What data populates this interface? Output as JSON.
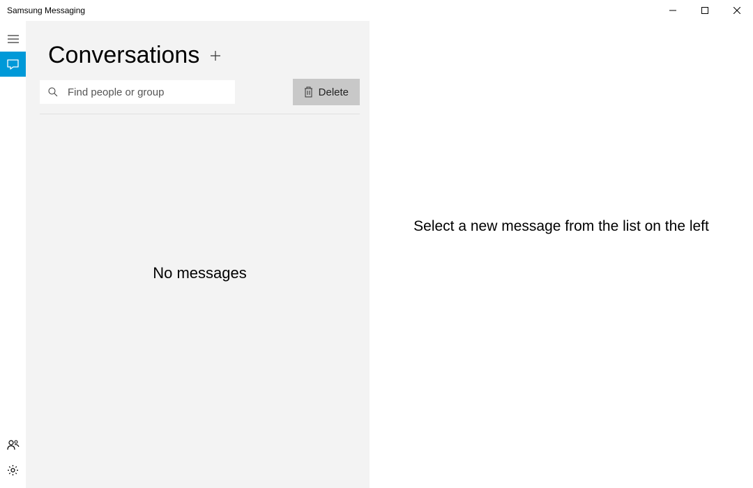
{
  "window": {
    "title": "Samsung Messaging"
  },
  "sidebar": {
    "menu_icon": "menu",
    "conversations_icon": "chat",
    "contacts_icon": "people",
    "settings_icon": "gear"
  },
  "panel": {
    "title": "Conversations",
    "search_placeholder": "Find people or group",
    "delete_label": "Delete",
    "empty_message": "No messages"
  },
  "detail": {
    "placeholder": "Select a new message from the list on the left"
  }
}
